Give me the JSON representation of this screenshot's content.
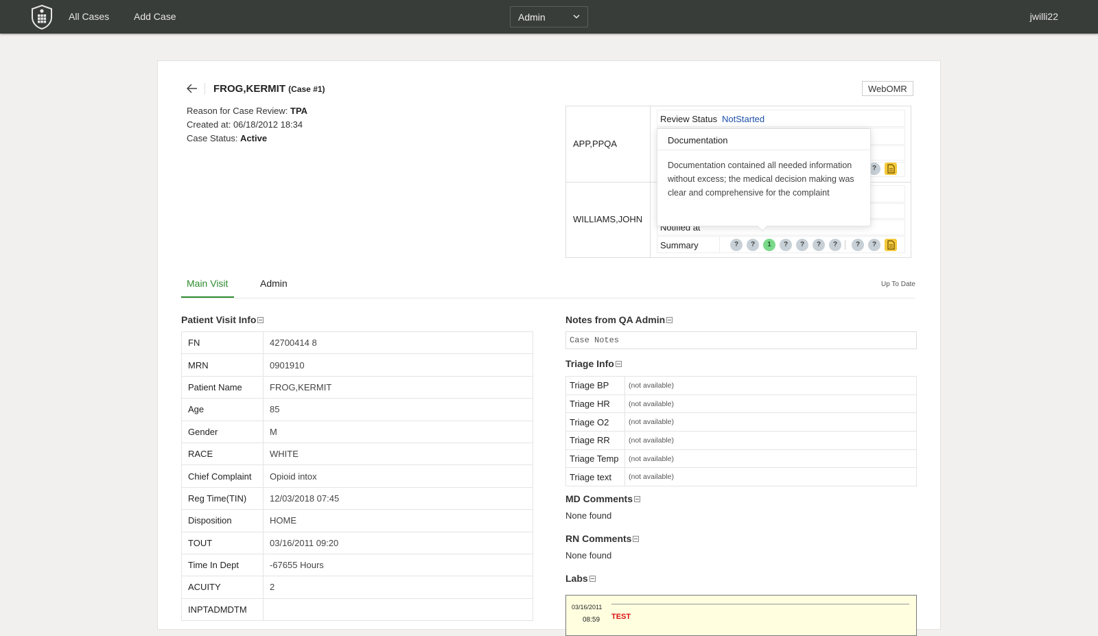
{
  "nav": {
    "all_cases": "All Cases",
    "add_case": "Add Case",
    "role": "Admin",
    "user": "jwilli22"
  },
  "case": {
    "patient": "FROG,KERMIT",
    "case_label": "(Case #1)",
    "reason_label": "Reason for Case Review: ",
    "reason": "TPA",
    "created_label": "Created at: ",
    "created": "06/18/2012 18:34",
    "status_label": "Case Status: ",
    "status": "Active",
    "webomr": "WebOMR"
  },
  "review": {
    "reviewers": [
      "APP,PPQA",
      "WILLIAMS,JOHN"
    ],
    "status_label": "Review Status",
    "status_value": "NotStarted",
    "notified_label": "Notified at",
    "summary_label": "Summary",
    "badges": [
      "?",
      "?",
      "1",
      "?",
      "?",
      "?",
      "?",
      "?",
      "?"
    ],
    "partial_badge": "?"
  },
  "popover": {
    "title": "Documentation",
    "body": "Documentation contained all needed information without excess; the medical decision making was clear and comprehensive for the complaint"
  },
  "tabs": [
    "Main Visit",
    "Admin"
  ],
  "up_to_date": "Up To Date",
  "visit": {
    "title": "Patient Visit Info",
    "rows": [
      {
        "k": "FN",
        "v": "42700414 8"
      },
      {
        "k": "MRN",
        "v": "0901910"
      },
      {
        "k": "Patient Name",
        "v": "FROG,KERMIT"
      },
      {
        "k": "Age",
        "v": "85"
      },
      {
        "k": "Gender",
        "v": "M"
      },
      {
        "k": "RACE",
        "v": "WHITE"
      },
      {
        "k": "Chief Complaint",
        "v": "Opioid intox"
      },
      {
        "k": "Reg Time(TIN)",
        "v": "12/03/2018 07:45"
      },
      {
        "k": "Disposition",
        "v": "HOME"
      },
      {
        "k": "TOUT",
        "v": "03/16/2011 09:20"
      },
      {
        "k": "Time In Dept",
        "v": "-67655 Hours"
      },
      {
        "k": "ACUITY",
        "v": "2"
      },
      {
        "k": "INPTADMDTM",
        "v": ""
      }
    ]
  },
  "notes": {
    "title": "Notes from QA Admin",
    "placeholder": "Case Notes"
  },
  "triage": {
    "title": "Triage Info",
    "rows": [
      {
        "k": "Triage BP",
        "v": "(not available)"
      },
      {
        "k": "Triage HR",
        "v": "(not available)"
      },
      {
        "k": "Triage O2",
        "v": "(not available)"
      },
      {
        "k": "Triage RR",
        "v": "(not available)"
      },
      {
        "k": "Triage Temp",
        "v": "(not available)"
      },
      {
        "k": "Triage text",
        "v": "(not available)"
      }
    ]
  },
  "md_comments": {
    "title": "MD Comments",
    "value": "None found"
  },
  "rn_comments": {
    "title": "RN Comments",
    "value": "None found"
  },
  "labs": {
    "title": "Labs",
    "date": "03/16/2011",
    "time": "08:59",
    "test": "TEST"
  }
}
